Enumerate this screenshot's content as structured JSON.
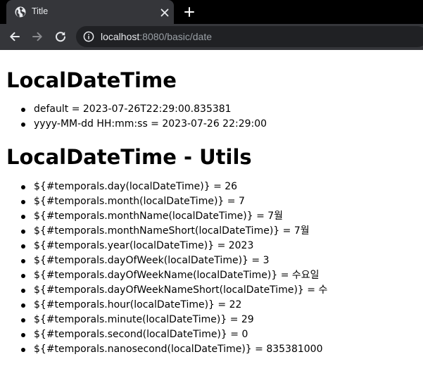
{
  "tab": {
    "title": "Title",
    "favicon": "globe-icon"
  },
  "address_bar": {
    "host": "localhost",
    "rest": ":8080/basic/date"
  },
  "sections": [
    {
      "heading": "LocalDateTime",
      "items": [
        "default = 2023-07-26T22:29:00.835381",
        "yyyy-MM-dd HH:mm:ss = 2023-07-26 22:29:00"
      ]
    },
    {
      "heading": "LocalDateTime - Utils",
      "items": [
        "${#temporals.day(localDateTime)} = 26",
        "${#temporals.month(localDateTime)} = 7",
        "${#temporals.monthName(localDateTime)} = 7월",
        "${#temporals.monthNameShort(localDateTime)} = 7월",
        "${#temporals.year(localDateTime)} = 2023",
        "${#temporals.dayOfWeek(localDateTime)} = 3",
        "${#temporals.dayOfWeekName(localDateTime)} = 수요일",
        "${#temporals.dayOfWeekNameShort(localDateTime)} = 수",
        "${#temporals.hour(localDateTime)} = 22",
        "${#temporals.minute(localDateTime)} = 29",
        "${#temporals.second(localDateTime)} = 0",
        "${#temporals.nanosecond(localDateTime)} = 835381000"
      ]
    }
  ],
  "colors": {
    "tab_strip": "#000000",
    "toolbar": "#35363a",
    "omnibox": "#202124",
    "chrome_text": "#e8eaed",
    "url_dim": "#9aa0a6"
  }
}
